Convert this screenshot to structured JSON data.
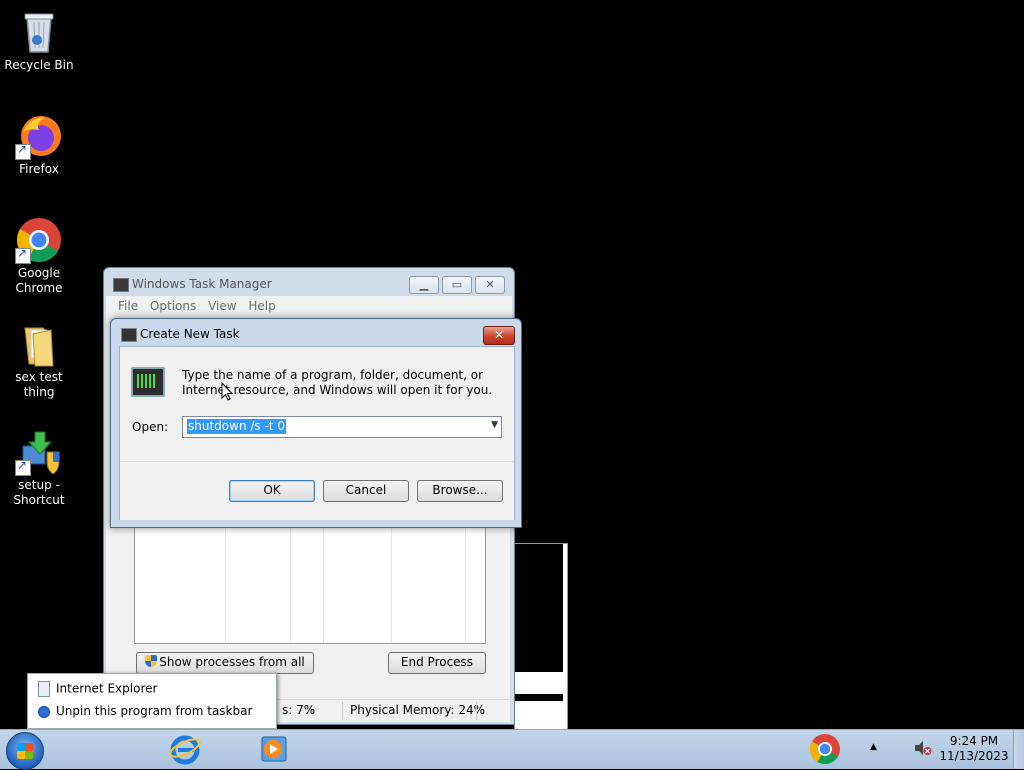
{
  "desktop": {
    "icons": [
      {
        "label": "Recycle Bin"
      },
      {
        "label": "Firefox"
      },
      {
        "label": "Google Chrome"
      },
      {
        "label": "sex test thing"
      },
      {
        "label": "setup - Shortcut"
      }
    ]
  },
  "task_manager": {
    "title": "Windows Task Manager",
    "menu": [
      "File",
      "Options",
      "View",
      "Help"
    ],
    "show_processes_label": "Show processes from all users",
    "end_process_label": "End Process",
    "status": {
      "cpu": "s: 7%",
      "memory": "Physical Memory: 24%"
    }
  },
  "create_task": {
    "title": "Create New Task",
    "description": "Type the name of a program, folder, document, or Internet resource, and Windows will open it for you.",
    "open_label": "Open:",
    "open_value": "shutdown /s -t 0",
    "ok_label": "OK",
    "cancel_label": "Cancel",
    "browse_label": "Browse...",
    "close_glyph": "✕"
  },
  "jump_list": {
    "items": [
      "Internet Explorer",
      "Unpin this program from taskbar"
    ]
  },
  "taskbar": {
    "time": "9:24 PM",
    "date": "11/13/2023"
  }
}
